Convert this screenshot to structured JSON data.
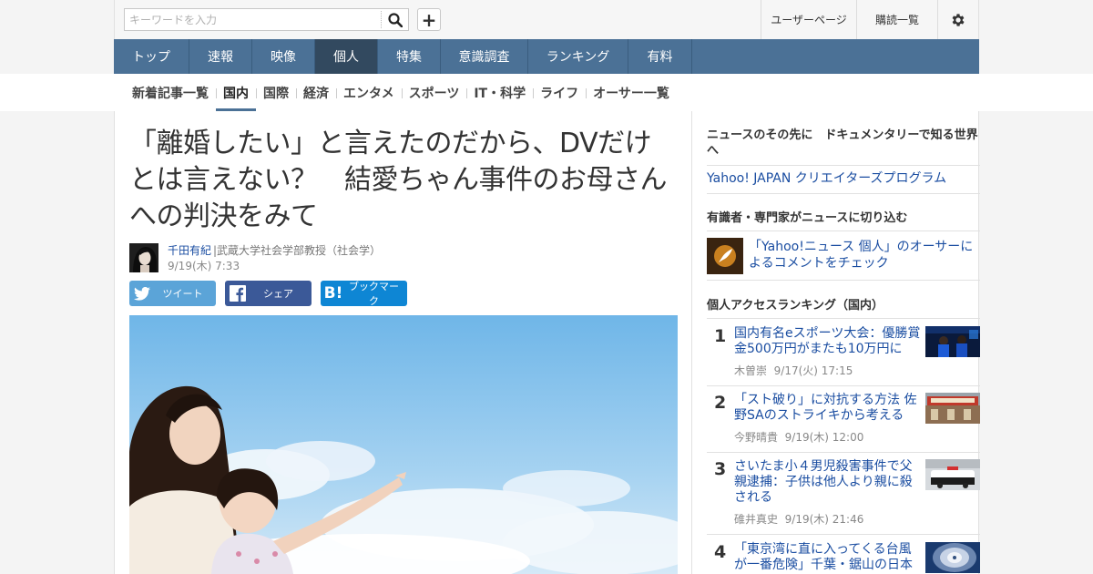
{
  "search": {
    "placeholder": "キーワードを入力"
  },
  "top_links": {
    "user_page": "ユーザーページ",
    "subscriptions": "購読一覧"
  },
  "main_nav": [
    "トップ",
    "速報",
    "映像",
    "個人",
    "特集",
    "意識調査",
    "ランキング",
    "有料"
  ],
  "main_nav_active": "個人",
  "sub_nav": [
    "新着記事一覧",
    "国内",
    "国際",
    "経済",
    "エンタメ",
    "スポーツ",
    "IT・科学",
    "ライフ",
    "オーサー一覧"
  ],
  "sub_nav_active": "国内",
  "article": {
    "headline": "「離婚したい」と言えたのだから、DVだけとは言えない？　結愛ちゃん事件のお母さんへの判決をみて",
    "author_name": "千田有紀",
    "author_title": "|武蔵大学社会学部教授（社会学）",
    "date": "9/19(木) 7:33"
  },
  "share": {
    "twitter": "ツイート",
    "facebook": "シェア",
    "hatena": "ブックマーク"
  },
  "sidebar": {
    "doc_title": "ニュースのその先に　ドキュメンタリーで知る世界へ",
    "creators_link": "Yahoo! JAPAN クリエイターズプログラム",
    "experts_title": "有識者・専門家がニュースに切り込む",
    "experts_link": "「Yahoo!ニュース 個人」のオーサーによるコメントをチェック",
    "ranking_title": "個人アクセスランキング（国内）",
    "ranking": [
      {
        "rank": "1",
        "title": "国内有名eスポーツ大会：優勝賞金500万円がまたも10万円に",
        "author": "木曽崇",
        "date": "9/17(火) 17:15"
      },
      {
        "rank": "2",
        "title": "「スト破り」に対抗する方法 佐野SAのストライキから考える",
        "author": "今野晴貴",
        "date": "9/19(木) 12:00"
      },
      {
        "rank": "3",
        "title": "さいたま小４男児殺害事件で父親逮捕：子供は他人より親に殺される",
        "author": "碓井真史",
        "date": "9/19(木) 21:46"
      },
      {
        "rank": "4",
        "title": "「東京湾に直に入ってくる台風が一番危険」千葉・鋸山の日本",
        "author": "",
        "date": ""
      }
    ]
  }
}
